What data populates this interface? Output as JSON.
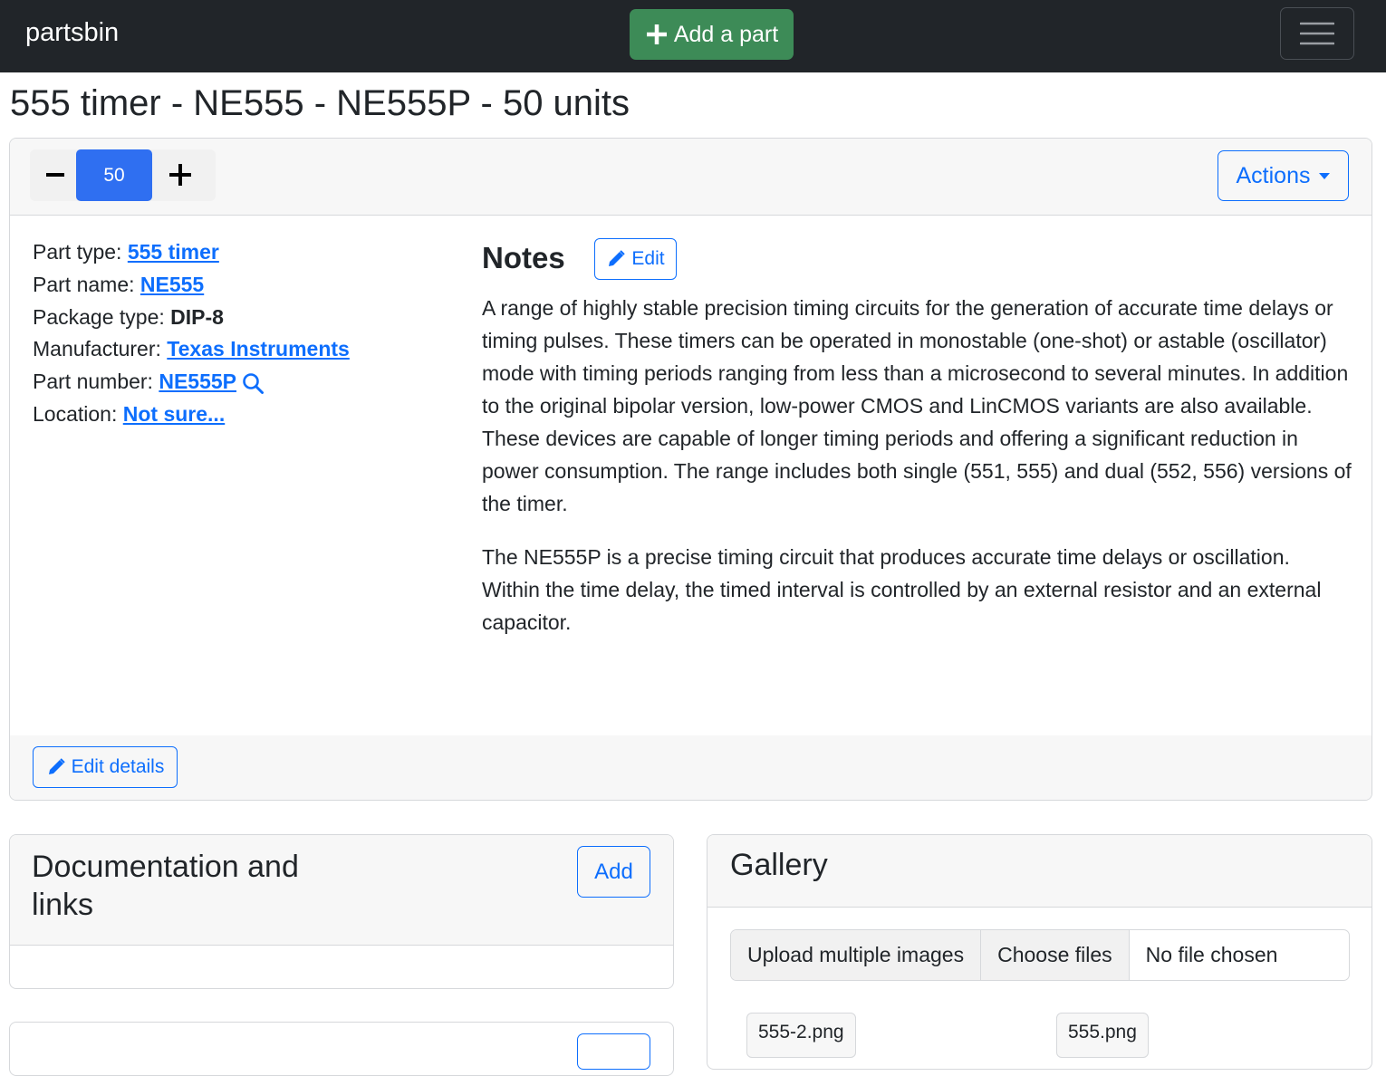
{
  "nav": {
    "brand": "partsbin",
    "add_part_label": "Add a part"
  },
  "page_title": "555 timer - NE555 - NE555P - 50 units",
  "toolbar": {
    "quantity": "50",
    "actions_label": "Actions"
  },
  "details": {
    "part_type_label": "Part type:",
    "part_type": "555 timer",
    "part_name_label": "Part name:",
    "part_name": "NE555",
    "package_type_label": "Package type:",
    "package_type": "DIP-8",
    "manufacturer_label": "Manufacturer:",
    "manufacturer": "Texas Instruments",
    "part_number_label": "Part number:",
    "part_number": "NE555P",
    "location_label": "Location:",
    "location": "Not sure..."
  },
  "notes": {
    "heading": "Notes",
    "edit_label": "Edit",
    "paragraphs": [
      "A range of highly stable precision timing circuits for the generation of accurate time delays or timing pulses. These timers can be operated in monostable (one-shot) or astable (oscillator) mode with timing periods ranging from less than a microsecond to several minutes. In addition to the original bipolar version, low-power CMOS and LinCMOS variants are also available. These devices are capable of longer timing periods and offering a significant reduction in power consumption. The range includes both single (551, 555) and dual (552, 556) versions of the timer.",
      "The NE555P is a precise timing circuit that produces accurate time delays or oscillation. Within the time delay, the timed interval is controlled by an external resistor and an external capacitor."
    ]
  },
  "edit_details_label": "Edit details",
  "documentation": {
    "title": "Documentation and links",
    "add_label": "Add"
  },
  "gallery": {
    "title": "Gallery",
    "upload_label": "Upload multiple images",
    "choose_label": "Choose files",
    "no_file_label": "No file chosen",
    "images": [
      "555-2.png",
      "555.png"
    ]
  },
  "colors": {
    "navbar": "#212529",
    "add_button": "#3d8b57",
    "primary": "#0d6efd",
    "quantity_bg": "#2f6ff1"
  }
}
